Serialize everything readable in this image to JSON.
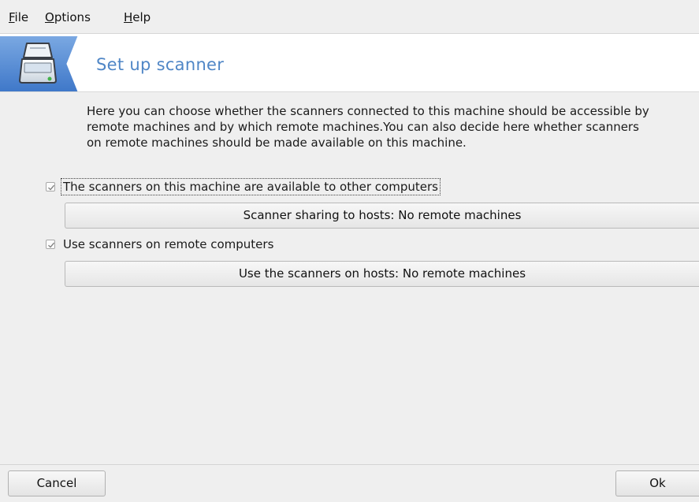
{
  "menu": {
    "file": {
      "mnemonic": "F",
      "rest": "ile"
    },
    "options": {
      "mnemonic": "O",
      "rest": "ptions"
    },
    "help": {
      "mnemonic": "H",
      "rest": "elp"
    }
  },
  "banner": {
    "title": "Set up scanner",
    "icon": "scanner-icon",
    "accent_color": "#4f86c6",
    "icon_bg_color": "#5a8fd6"
  },
  "description": "Here you can choose whether the scanners connected to this machine should be accessible by remote machines and by which remote machines.You can also decide here whether scanners on remote machines should be made available on this machine.",
  "sharing": {
    "checkbox_label": "The scanners on this machine are available to other computers",
    "checked": true,
    "button_label": "Scanner sharing to hosts: No remote machines"
  },
  "remote": {
    "checkbox_label": "Use scanners on remote computers",
    "checked": true,
    "button_label": "Use the scanners on hosts: No remote machines"
  },
  "buttons": {
    "cancel": "Cancel",
    "ok": "Ok"
  }
}
